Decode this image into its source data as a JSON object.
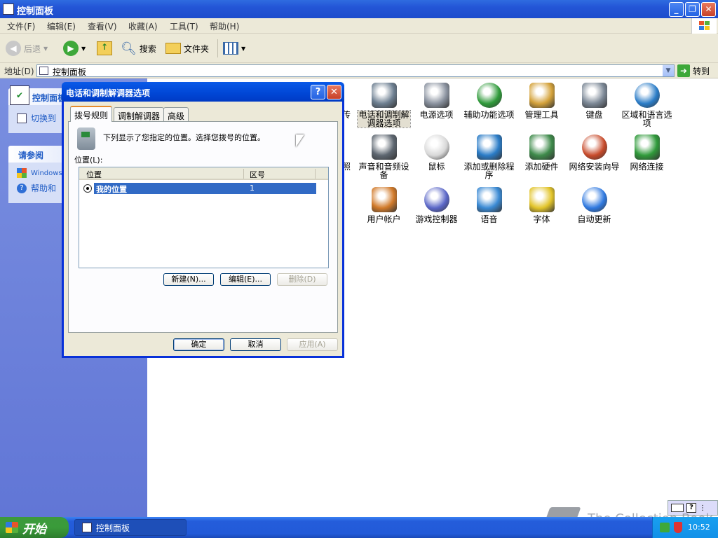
{
  "window": {
    "title": "控制面板"
  },
  "menu": [
    "文件(F)",
    "编辑(E)",
    "查看(V)",
    "收藏(A)",
    "工具(T)",
    "帮助(H)"
  ],
  "toolbar": {
    "back": "后退",
    "search": "搜索",
    "folders": "文件夹"
  },
  "address": {
    "label": "地址(D)",
    "value": "控制面板",
    "go": "转到"
  },
  "leftpane": {
    "panel_title": "控制面板",
    "switch_view": "切换到",
    "see_also_title": "请参阅",
    "windows_update": "Windows",
    "help": "帮助和"
  },
  "items": [
    {
      "label": "传",
      "icon": "fax-icon"
    },
    {
      "label": "电话和调制解调器选项",
      "icon": "phone-modem-icon"
    },
    {
      "label": "电源选项",
      "icon": "power-options-icon"
    },
    {
      "label": "辅助功能选项",
      "icon": "accessibility-icon"
    },
    {
      "label": "管理工具",
      "icon": "admin-tools-icon"
    },
    {
      "label": "键盘",
      "icon": "keyboard-icon"
    },
    {
      "label": "区域和语言选项",
      "icon": "globe-icon"
    },
    {
      "label": "照",
      "icon": "scanner-icon"
    },
    {
      "label": "声音和音频设备",
      "icon": "speaker-icon"
    },
    {
      "label": "鼠标",
      "icon": "mouse-icon"
    },
    {
      "label": "添加或删除程序",
      "icon": "add-remove-icon"
    },
    {
      "label": "添加硬件",
      "icon": "add-hardware-icon"
    },
    {
      "label": "网络安装向导",
      "icon": "network-setup-icon"
    },
    {
      "label": "网络连接",
      "icon": "network-connections-icon"
    },
    {
      "label": "用户帐户",
      "icon": "user-accounts-icon"
    },
    {
      "label": "游戏控制器",
      "icon": "game-controller-icon"
    },
    {
      "label": "语音",
      "icon": "speech-icon"
    },
    {
      "label": "字体",
      "icon": "fonts-icon"
    },
    {
      "label": "自动更新",
      "icon": "windows-update-icon"
    }
  ],
  "dialog": {
    "title": "电话和调制解调器选项",
    "tabs": [
      "拨号规则",
      "调制解调器",
      "高级"
    ],
    "description": "下列显示了您指定的位置。选择您拨号的位置。",
    "locations_label": "位置(L):",
    "columns": [
      "位置",
      "区号"
    ],
    "rows": [
      {
        "location": "我的位置",
        "area_code": "1"
      }
    ],
    "new_button": "新建(N)...",
    "edit_button": "编辑(E)...",
    "delete_button": "删除(D)",
    "ok": "确定",
    "cancel": "取消",
    "apply": "应用(A)"
  },
  "taskbar": {
    "start": "开始",
    "task": "控制面板",
    "clock": "10:52"
  },
  "watermark": "The Collection Book",
  "colors": {
    "titlebar": "#2355d6",
    "selection": "#316ac5",
    "taskbar": "#245ddb",
    "start": "#3a9b3a"
  }
}
